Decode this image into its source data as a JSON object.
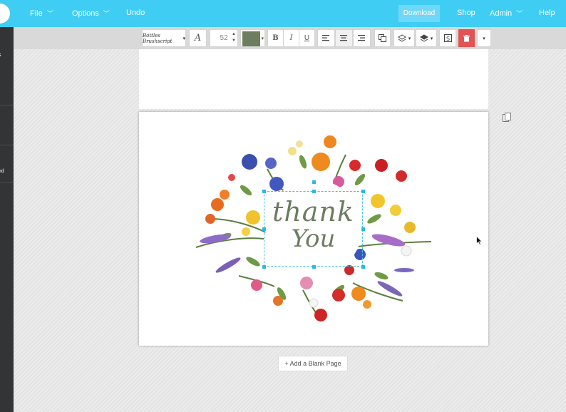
{
  "nav": {
    "file": "File",
    "options": "Options",
    "undo": "Undo",
    "download": "Download",
    "shop": "Shop",
    "admin": "Admin",
    "help": "Help"
  },
  "sidebar": {
    "items": [
      "es",
      "ts",
      "und"
    ]
  },
  "toolbar": {
    "font_name": "Bottles Brushscript",
    "font_size": "52",
    "text_color": "#6d7d60",
    "bold": "B",
    "italic": "I",
    "underline": "U",
    "font_style_icon": "A"
  },
  "card": {
    "line1": "thank",
    "line2": "You"
  },
  "add_blank_page": "+ Add a Blank Page",
  "colors": {
    "topbar": "#3fcdf4",
    "sidebar": "#333436",
    "delete": "#e25353",
    "selection": "#2db7e6"
  }
}
